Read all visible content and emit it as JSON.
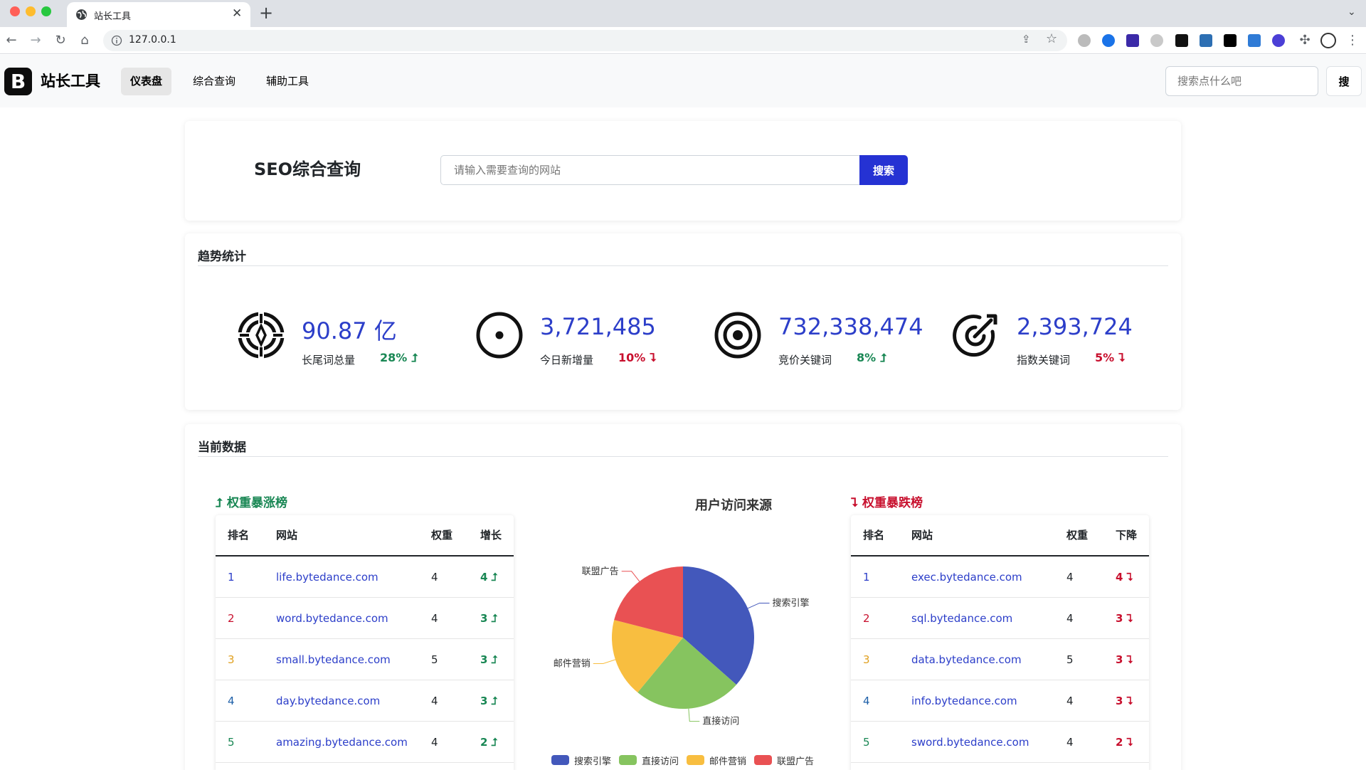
{
  "browser": {
    "tab_title": "站长工具",
    "url": "127.0.0.1"
  },
  "navbar": {
    "brand_logo": "B",
    "brand_name": "站长工具",
    "links": [
      "仪表盘",
      "综合查询",
      "辅助工具"
    ],
    "search_placeholder": "搜索点什么吧",
    "search_button": "搜"
  },
  "seo": {
    "title": "SEO综合查询",
    "input_placeholder": "请输入需要查询的网站",
    "button": "搜索"
  },
  "trend": {
    "heading": "趋势统计",
    "stats": [
      {
        "value": "90.87 亿",
        "label": "长尾词总量",
        "change": "28% ⮥",
        "direction": "up",
        "icon": "crosshair-icon"
      },
      {
        "value": "3,721,485",
        "label": "今日新增量",
        "change": "10% ⮧",
        "direction": "down",
        "icon": "circle-dot-icon"
      },
      {
        "value": "732,338,474",
        "label": "竞价关键词",
        "change": "8% ⮥",
        "direction": "up",
        "icon": "bullseye-icon"
      },
      {
        "value": "2,393,724",
        "label": "指数关键词",
        "change": "5% ⮧",
        "direction": "down",
        "icon": "target-arrow-icon"
      }
    ]
  },
  "current": {
    "heading": "当前数据",
    "rise": {
      "title": "⮥ 权重暴涨榜",
      "headers": [
        "排名",
        "网站",
        "权重",
        "增长"
      ],
      "rows": [
        {
          "rank": "1",
          "site": "life.bytedance.com",
          "weight": "4",
          "change": "4 ⮥"
        },
        {
          "rank": "2",
          "site": "word.bytedance.com",
          "weight": "4",
          "change": "3 ⮥"
        },
        {
          "rank": "3",
          "site": "small.bytedance.com",
          "weight": "5",
          "change": "3 ⮥"
        },
        {
          "rank": "4",
          "site": "day.bytedance.com",
          "weight": "4",
          "change": "3 ⮥"
        },
        {
          "rank": "5",
          "site": "amazing.bytedance.com",
          "weight": "4",
          "change": "2 ⮥"
        }
      ]
    },
    "fall": {
      "title": "⮧ 权重暴跌榜",
      "headers": [
        "排名",
        "网站",
        "权重",
        "下降"
      ],
      "rows": [
        {
          "rank": "1",
          "site": "exec.bytedance.com",
          "weight": "4",
          "change": "4 ⮧"
        },
        {
          "rank": "2",
          "site": "sql.bytedance.com",
          "weight": "4",
          "change": "3 ⮧"
        },
        {
          "rank": "3",
          "site": "data.bytedance.com",
          "weight": "5",
          "change": "3 ⮧"
        },
        {
          "rank": "4",
          "site": "info.bytedance.com",
          "weight": "4",
          "change": "3 ⮧"
        },
        {
          "rank": "5",
          "site": "sword.bytedance.com",
          "weight": "4",
          "change": "2 ⮧"
        }
      ]
    },
    "rank_colors": [
      "#2c3ec9",
      "#c8102e",
      "#e0a020",
      "#1d5fa8",
      "#198754"
    ]
  },
  "chart_data": {
    "type": "pie",
    "title": "用户访问来源",
    "labels": [
      "搜索引擎",
      "直接访问",
      "邮件营销",
      "联盟广告"
    ],
    "values": [
      36.5,
      24.5,
      18,
      21
    ],
    "colors": [
      "#4358bb",
      "#86c45f",
      "#f8be40",
      "#e95153"
    ],
    "legend": "bottom"
  }
}
